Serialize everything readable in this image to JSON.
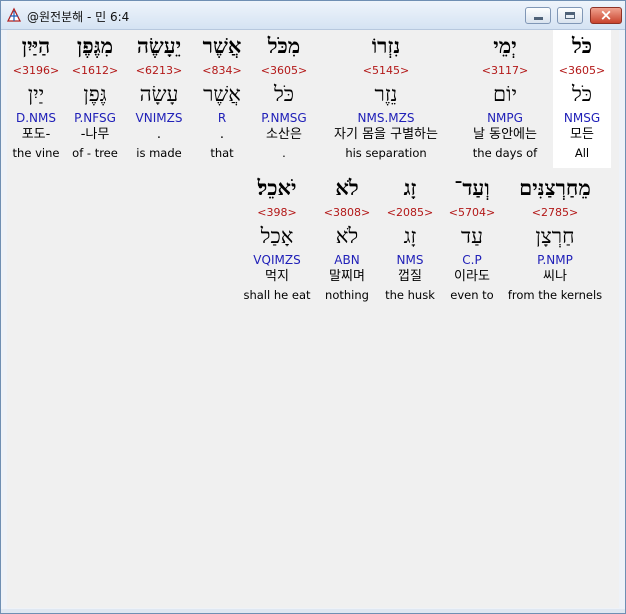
{
  "window": {
    "title": "@원전분해 - 민 6:4"
  },
  "rows": [
    {
      "words": [
        {
          "surface": "כֹּל",
          "strongs": "<3605>",
          "lexeme": "כֹּל",
          "morph": "NMSG",
          "korean": "모든",
          "english": "All",
          "highlight": true
        },
        {
          "surface": "יְמֵי",
          "strongs": "<3117>",
          "lexeme": "יוֹם",
          "morph": "NMPG",
          "korean": "날 동안에는",
          "english": "the days of"
        },
        {
          "surface": "נִזְרוֹ",
          "strongs": "<5145>",
          "lexeme": "נֵזֶר",
          "morph": "NMS.MZS",
          "korean": "자기 몸을 구별하는",
          "english": "his separation"
        },
        {
          "surface": "מִכֹּל",
          "strongs": "<3605>",
          "lexeme": "כֹּל",
          "morph": "P.NMSG",
          "korean": "소산은",
          "english": "."
        },
        {
          "surface": "אֲשֶׁר",
          "strongs": "<834>",
          "lexeme": "אֲשֶׁר",
          "morph": "R",
          "korean": ".",
          "english": "that"
        },
        {
          "surface": "יֵעָשֶׂה",
          "strongs": "<6213>",
          "lexeme": "עָשָׂה",
          "morph": "VNIMZS",
          "korean": ".",
          "english": "is made"
        },
        {
          "surface": "מִגֶּפֶן",
          "strongs": "<1612>",
          "lexeme": "גֶּפֶן",
          "morph": "P.NFSG",
          "korean": "-나무",
          "english": "of - tree"
        },
        {
          "surface": "הַיַּיִן",
          "strongs": "<3196>",
          "lexeme": "יַיִן",
          "morph": "D.NMS",
          "korean": "포도-",
          "english": "the vine"
        }
      ]
    },
    {
      "words": [
        {
          "surface": "מֵחַרְצַנִּים",
          "strongs": "<2785>",
          "lexeme": "חַרְצָן",
          "morph": "P.NMP",
          "korean": "씨나",
          "english": "from the kernels"
        },
        {
          "surface": "וְעַד־",
          "strongs": "<5704>",
          "lexeme": "עַד",
          "morph": "C.P",
          "korean": "이라도",
          "english": "even to"
        },
        {
          "surface": "זָג",
          "strongs": "<2085>",
          "lexeme": "זָג",
          "morph": "NMS",
          "korean": "껍질",
          "english": "the husk"
        },
        {
          "surface": "לֹא",
          "strongs": "<3808>",
          "lexeme": "לֹא",
          "morph": "ABN",
          "korean": "말찌며",
          "english": "nothing"
        },
        {
          "surface": "יֹאכֵל׃",
          "strongs": "<398>",
          "lexeme": "אָכַל",
          "morph": "VQIMZS",
          "korean": "먹지",
          "english": "shall he eat"
        }
      ]
    }
  ]
}
